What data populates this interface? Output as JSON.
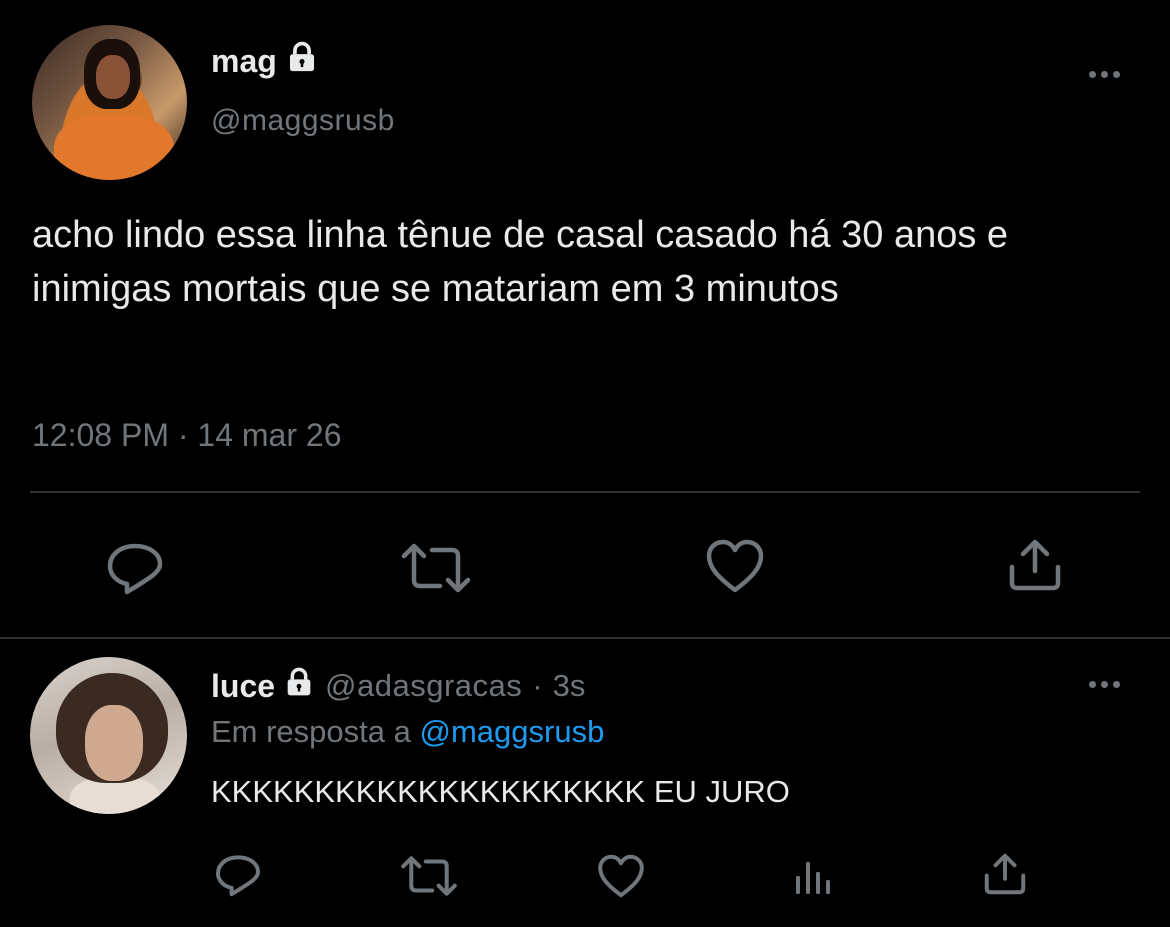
{
  "main_tweet": {
    "author_name": "mag",
    "author_handle": "@maggsrusb",
    "text": "acho lindo essa linha tênue de casal casado há 30 anos e inimigas mortais que se matariam em 3 minutos",
    "time": "12:08 PM",
    "separator": "·",
    "date": "14 mar 26",
    "author_locked_icon": "lock-icon",
    "more_icon": "more-horizontal-icon",
    "actions": [
      "reply-icon",
      "retweet-icon",
      "like-icon",
      "share-icon"
    ]
  },
  "reply_tweet": {
    "author_name": "luce",
    "author_handle": "@adasgracas",
    "separator": "·",
    "time_ago": "3s",
    "reply_prefix": "Em resposta a",
    "reply_to_handle": "@maggsrusb",
    "text": "KKKKKKKKKKKKKKKKKKKKK EU JURO",
    "author_locked_icon": "lock-icon",
    "more_icon": "more-horizontal-icon",
    "actions": [
      "reply-icon",
      "retweet-icon",
      "like-icon",
      "views-icon",
      "share-icon"
    ]
  },
  "colors": {
    "background": "#000000",
    "primary_text": "#e7e9ea",
    "secondary_text": "#71767b",
    "link": "#1d9bf0",
    "divider": "#2f3336"
  }
}
